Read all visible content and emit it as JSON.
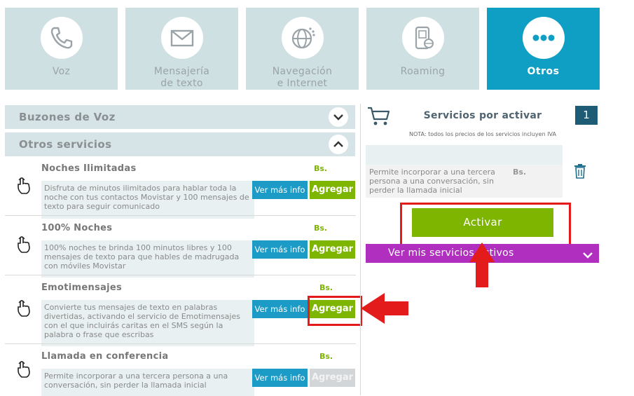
{
  "tabs": [
    {
      "label": "Voz",
      "icon": "phone-icon",
      "active": false
    },
    {
      "label": "Mensajería\nde texto",
      "icon": "envelope-icon",
      "active": false
    },
    {
      "label": "Navegación\ne Internet",
      "icon": "globe-icon",
      "active": false
    },
    {
      "label": "Roaming",
      "icon": "roaming-phone-icon",
      "active": false
    },
    {
      "label": "Otros",
      "icon": "more-dots-icon",
      "active": true
    }
  ],
  "sections": [
    {
      "title": "Buzones de Voz",
      "expanded": false
    },
    {
      "title": "Otros servicios",
      "expanded": true
    }
  ],
  "services": [
    {
      "title": "Noches Ilimitadas",
      "price": "Bs.",
      "description": "Disfruta de minutos ilimitados para hablar toda la noche con tus contactos Movistar y 100 mensajes de texto para seguir comunicado",
      "info_label": "Ver más info",
      "add_label": "Agregar",
      "add_enabled": true
    },
    {
      "title": "100% Noches",
      "price": "Bs.",
      "description": "100% noches te brinda 100 minutos libres y 100 mensajes de texto para que hables de madrugada con móviles Movistar",
      "info_label": "Ver más info",
      "add_label": "Agregar",
      "add_enabled": true
    },
    {
      "title": "Emotimensajes",
      "price": "Bs.",
      "description": "Convierte tus mensajes de texto en palabras divertidas, activando el servicio de Emotimensajes con el que incluirás caritas en el SMS según la palabra o frase que escribas",
      "info_label": "Ver más info",
      "add_label": "Agregar",
      "add_enabled": true,
      "highlighted": true
    },
    {
      "title": "Llamada en conferencia",
      "price": "Bs.",
      "description": "Permite incorporar a una tercera persona a una conversación, sin perder la llamada inicial",
      "info_label": "Ver más info",
      "add_label": "Agregar",
      "add_enabled": false
    }
  ],
  "cart": {
    "title": "Servicios por activar",
    "count": "1",
    "note": "NOTA: todos los precios de los servicios incluyen IVA",
    "item": {
      "description": "Permite incorporar a una tercera persona a una conversación, sin perder la llamada inicial",
      "price": "Bs."
    },
    "activate_label": "Activar",
    "my_services_label": "Ver mis servicios activos"
  },
  "colors": {
    "tile_bg": "#cfe0e3",
    "tile_active": "#0f9ec4",
    "accent_green": "#7db500",
    "info_blue": "#1b9bc6",
    "purple": "#b02fbf",
    "annotation_red": "#e31b1b"
  }
}
